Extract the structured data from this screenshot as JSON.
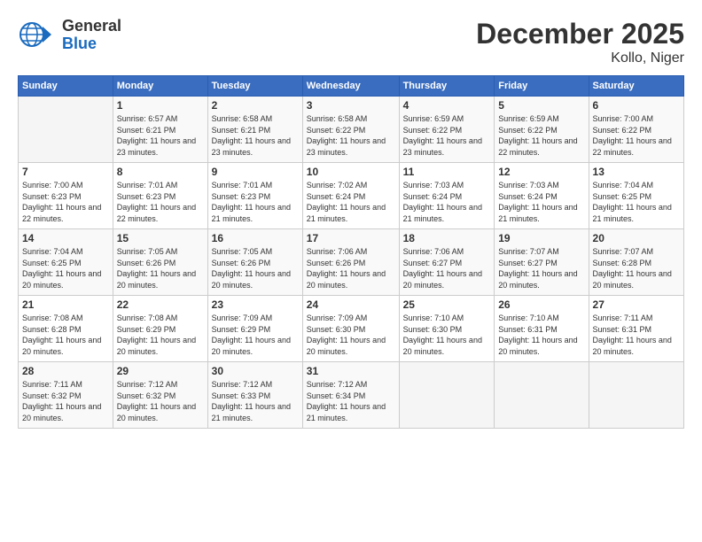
{
  "logo": {
    "general": "General",
    "blue": "Blue"
  },
  "header": {
    "month": "December 2025",
    "location": "Kollo, Niger"
  },
  "days_of_week": [
    "Sunday",
    "Monday",
    "Tuesday",
    "Wednesday",
    "Thursday",
    "Friday",
    "Saturday"
  ],
  "weeks": [
    [
      {
        "day": "",
        "sunrise": "",
        "sunset": "",
        "daylight": ""
      },
      {
        "day": "1",
        "sunrise": "Sunrise: 6:57 AM",
        "sunset": "Sunset: 6:21 PM",
        "daylight": "Daylight: 11 hours and 23 minutes."
      },
      {
        "day": "2",
        "sunrise": "Sunrise: 6:58 AM",
        "sunset": "Sunset: 6:21 PM",
        "daylight": "Daylight: 11 hours and 23 minutes."
      },
      {
        "day": "3",
        "sunrise": "Sunrise: 6:58 AM",
        "sunset": "Sunset: 6:22 PM",
        "daylight": "Daylight: 11 hours and 23 minutes."
      },
      {
        "day": "4",
        "sunrise": "Sunrise: 6:59 AM",
        "sunset": "Sunset: 6:22 PM",
        "daylight": "Daylight: 11 hours and 23 minutes."
      },
      {
        "day": "5",
        "sunrise": "Sunrise: 6:59 AM",
        "sunset": "Sunset: 6:22 PM",
        "daylight": "Daylight: 11 hours and 22 minutes."
      },
      {
        "day": "6",
        "sunrise": "Sunrise: 7:00 AM",
        "sunset": "Sunset: 6:22 PM",
        "daylight": "Daylight: 11 hours and 22 minutes."
      }
    ],
    [
      {
        "day": "7",
        "sunrise": "Sunrise: 7:00 AM",
        "sunset": "Sunset: 6:23 PM",
        "daylight": "Daylight: 11 hours and 22 minutes."
      },
      {
        "day": "8",
        "sunrise": "Sunrise: 7:01 AM",
        "sunset": "Sunset: 6:23 PM",
        "daylight": "Daylight: 11 hours and 22 minutes."
      },
      {
        "day": "9",
        "sunrise": "Sunrise: 7:01 AM",
        "sunset": "Sunset: 6:23 PM",
        "daylight": "Daylight: 11 hours and 21 minutes."
      },
      {
        "day": "10",
        "sunrise": "Sunrise: 7:02 AM",
        "sunset": "Sunset: 6:24 PM",
        "daylight": "Daylight: 11 hours and 21 minutes."
      },
      {
        "day": "11",
        "sunrise": "Sunrise: 7:03 AM",
        "sunset": "Sunset: 6:24 PM",
        "daylight": "Daylight: 11 hours and 21 minutes."
      },
      {
        "day": "12",
        "sunrise": "Sunrise: 7:03 AM",
        "sunset": "Sunset: 6:24 PM",
        "daylight": "Daylight: 11 hours and 21 minutes."
      },
      {
        "day": "13",
        "sunrise": "Sunrise: 7:04 AM",
        "sunset": "Sunset: 6:25 PM",
        "daylight": "Daylight: 11 hours and 21 minutes."
      }
    ],
    [
      {
        "day": "14",
        "sunrise": "Sunrise: 7:04 AM",
        "sunset": "Sunset: 6:25 PM",
        "daylight": "Daylight: 11 hours and 20 minutes."
      },
      {
        "day": "15",
        "sunrise": "Sunrise: 7:05 AM",
        "sunset": "Sunset: 6:26 PM",
        "daylight": "Daylight: 11 hours and 20 minutes."
      },
      {
        "day": "16",
        "sunrise": "Sunrise: 7:05 AM",
        "sunset": "Sunset: 6:26 PM",
        "daylight": "Daylight: 11 hours and 20 minutes."
      },
      {
        "day": "17",
        "sunrise": "Sunrise: 7:06 AM",
        "sunset": "Sunset: 6:26 PM",
        "daylight": "Daylight: 11 hours and 20 minutes."
      },
      {
        "day": "18",
        "sunrise": "Sunrise: 7:06 AM",
        "sunset": "Sunset: 6:27 PM",
        "daylight": "Daylight: 11 hours and 20 minutes."
      },
      {
        "day": "19",
        "sunrise": "Sunrise: 7:07 AM",
        "sunset": "Sunset: 6:27 PM",
        "daylight": "Daylight: 11 hours and 20 minutes."
      },
      {
        "day": "20",
        "sunrise": "Sunrise: 7:07 AM",
        "sunset": "Sunset: 6:28 PM",
        "daylight": "Daylight: 11 hours and 20 minutes."
      }
    ],
    [
      {
        "day": "21",
        "sunrise": "Sunrise: 7:08 AM",
        "sunset": "Sunset: 6:28 PM",
        "daylight": "Daylight: 11 hours and 20 minutes."
      },
      {
        "day": "22",
        "sunrise": "Sunrise: 7:08 AM",
        "sunset": "Sunset: 6:29 PM",
        "daylight": "Daylight: 11 hours and 20 minutes."
      },
      {
        "day": "23",
        "sunrise": "Sunrise: 7:09 AM",
        "sunset": "Sunset: 6:29 PM",
        "daylight": "Daylight: 11 hours and 20 minutes."
      },
      {
        "day": "24",
        "sunrise": "Sunrise: 7:09 AM",
        "sunset": "Sunset: 6:30 PM",
        "daylight": "Daylight: 11 hours and 20 minutes."
      },
      {
        "day": "25",
        "sunrise": "Sunrise: 7:10 AM",
        "sunset": "Sunset: 6:30 PM",
        "daylight": "Daylight: 11 hours and 20 minutes."
      },
      {
        "day": "26",
        "sunrise": "Sunrise: 7:10 AM",
        "sunset": "Sunset: 6:31 PM",
        "daylight": "Daylight: 11 hours and 20 minutes."
      },
      {
        "day": "27",
        "sunrise": "Sunrise: 7:11 AM",
        "sunset": "Sunset: 6:31 PM",
        "daylight": "Daylight: 11 hours and 20 minutes."
      }
    ],
    [
      {
        "day": "28",
        "sunrise": "Sunrise: 7:11 AM",
        "sunset": "Sunset: 6:32 PM",
        "daylight": "Daylight: 11 hours and 20 minutes."
      },
      {
        "day": "29",
        "sunrise": "Sunrise: 7:12 AM",
        "sunset": "Sunset: 6:32 PM",
        "daylight": "Daylight: 11 hours and 20 minutes."
      },
      {
        "day": "30",
        "sunrise": "Sunrise: 7:12 AM",
        "sunset": "Sunset: 6:33 PM",
        "daylight": "Daylight: 11 hours and 21 minutes."
      },
      {
        "day": "31",
        "sunrise": "Sunrise: 7:12 AM",
        "sunset": "Sunset: 6:34 PM",
        "daylight": "Daylight: 11 hours and 21 minutes."
      },
      {
        "day": "",
        "sunrise": "",
        "sunset": "",
        "daylight": ""
      },
      {
        "day": "",
        "sunrise": "",
        "sunset": "",
        "daylight": ""
      },
      {
        "day": "",
        "sunrise": "",
        "sunset": "",
        "daylight": ""
      }
    ]
  ]
}
